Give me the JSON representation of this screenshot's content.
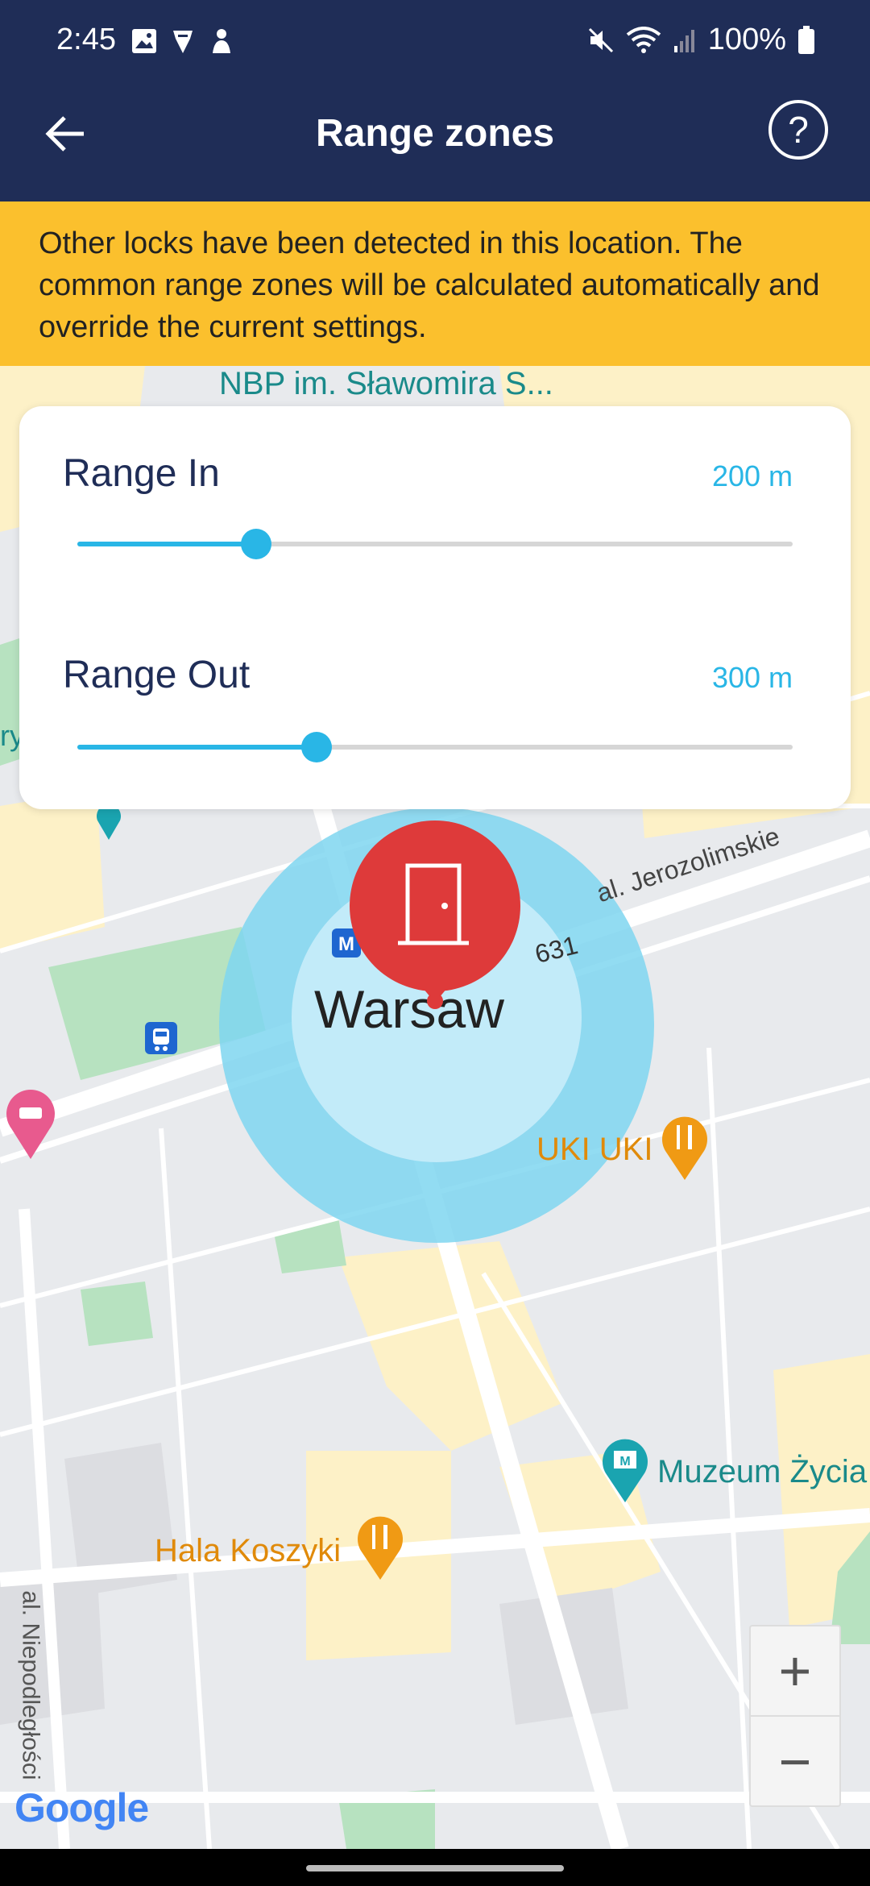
{
  "status_bar": {
    "time": "2:45",
    "battery": "100%",
    "icons_left": [
      "image-icon",
      "shield-bell-icon",
      "person-icon"
    ],
    "icons_right": [
      "mute-icon",
      "wifi-icon",
      "signal-icon",
      "battery-icon"
    ]
  },
  "app_bar": {
    "title": "Range zones",
    "help_label": "?"
  },
  "banner": {
    "text": "Other locks have been detected in this location. The common range zones will be calculated automatically and override the current settings."
  },
  "ranges": {
    "in": {
      "label": "Range In",
      "value": "200 m",
      "level": 0.25
    },
    "out": {
      "label": "Range Out",
      "value": "300 m",
      "level": 0.335
    }
  },
  "map": {
    "labels": {
      "nbp": "NBP im. Sławomira S...",
      "street_number": "631",
      "jerozolimskie": "al. Jerozolimskie",
      "city": "Warsaw",
      "uki": "UKI UKI",
      "muzeum": "Muzeum Życia",
      "hala": "Hala Koszyki",
      "niepodleglosci": "al. Niepodległości",
      "edge": "ry"
    },
    "zoom_in": "+",
    "zoom_out": "−",
    "attribution": "Google",
    "colors": {
      "outer_zone": "#7fd6f0",
      "inner_zone": "#c8ecfa",
      "pin": "#de3a3a",
      "accent": "#29b6e6",
      "header": "#1f2d57",
      "banner": "#fbc02d"
    }
  }
}
